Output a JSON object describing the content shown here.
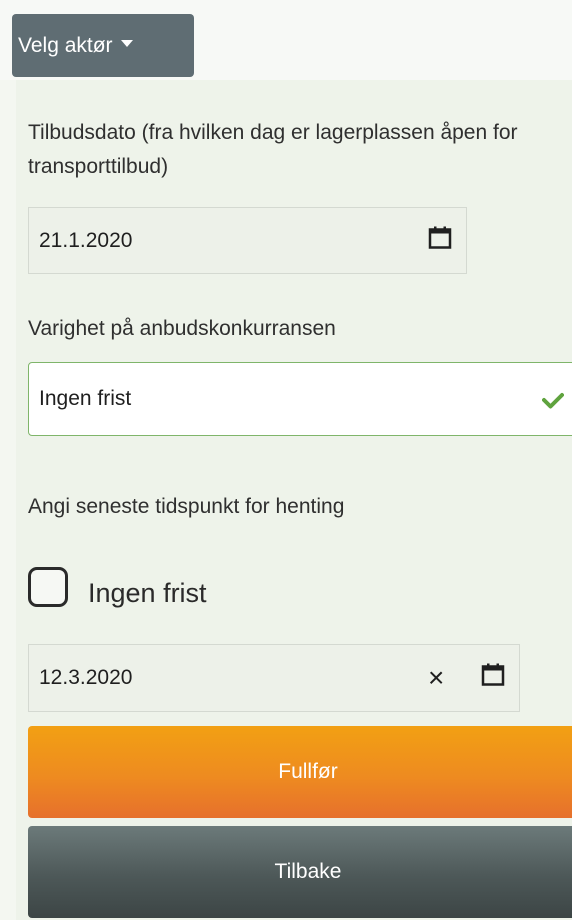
{
  "header": {
    "actor_menu_label": "Velg aktør"
  },
  "form": {
    "offer_date_label": "Tilbudsdato (fra hvilken dag er lagerplassen åpen for transporttilbud)",
    "offer_date_value": "21.1.2020",
    "duration_label": "Varighet på anbudskonkurransen",
    "duration_selected": "Ingen frist",
    "pickup_deadline_label": "Angi seneste tidspunkt for henting",
    "no_deadline_checkbox_label": "Ingen frist",
    "no_deadline_checked": false,
    "pickup_date_value": "12.3.2020",
    "clear_glyph": "×"
  },
  "actions": {
    "finish_label": "Fullfør",
    "back_label": "Tilbake"
  },
  "colors": {
    "accent_green": "#7fb56a",
    "finish_orange": "#ee8b20",
    "back_gray": "#4d5858",
    "actor_button": "#5f6d73"
  }
}
